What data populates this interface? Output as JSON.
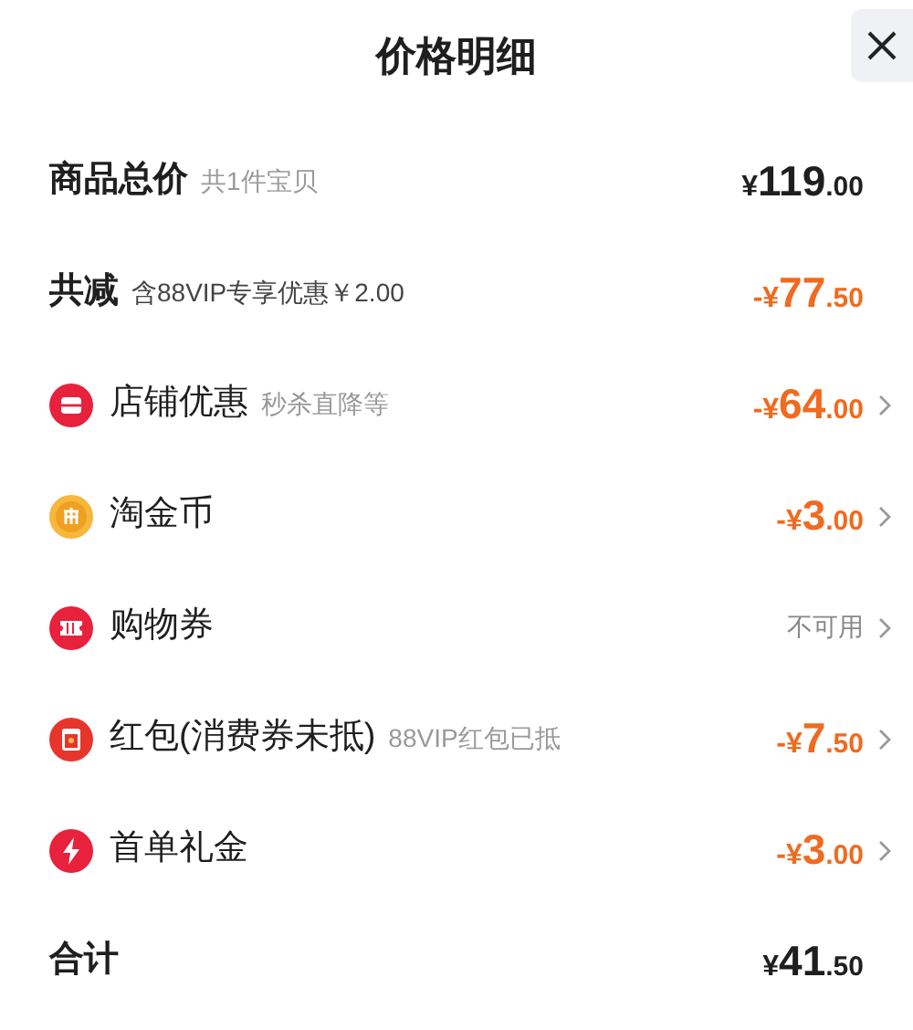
{
  "title": "价格明细",
  "rows": [
    {
      "kind": "summary",
      "label": "商品总价",
      "note": "共1件宝贝",
      "amount": {
        "sign": "¥",
        "integer": "119",
        "decimal": ".00",
        "discount": false
      },
      "chevron": false
    },
    {
      "kind": "summary",
      "label": "共减",
      "note": "含88VIP专享优惠￥2.00",
      "amount": {
        "sign": "-¥",
        "integer": "77",
        "decimal": ".50",
        "discount": true
      },
      "chevron": false
    },
    {
      "kind": "store",
      "label": "店铺优惠",
      "note": "秒杀直降等",
      "amount": {
        "sign": "-¥",
        "integer": "64",
        "decimal": ".00",
        "discount": true
      },
      "chevron": true
    },
    {
      "kind": "coin",
      "label": "淘金币",
      "amount": {
        "sign": "-¥",
        "integer": "3",
        "decimal": ".00",
        "discount": true
      },
      "chevron": true
    },
    {
      "kind": "ticket",
      "label": "购物券",
      "status": "不可用",
      "chevron": true
    },
    {
      "kind": "envelope",
      "label": "红包(消费券未抵)",
      "note": "88VIP红包已抵",
      "amount": {
        "sign": "-¥",
        "integer": "7",
        "decimal": ".50",
        "discount": true
      },
      "chevron": true
    },
    {
      "kind": "flash",
      "label": "首单礼金",
      "amount": {
        "sign": "-¥",
        "integer": "3",
        "decimal": ".00",
        "discount": true
      },
      "chevron": true
    },
    {
      "kind": "total",
      "label": "合计",
      "amount": {
        "sign": "¥",
        "integer": "41",
        "decimal": ".50",
        "discount": false
      },
      "chevron": false
    }
  ]
}
